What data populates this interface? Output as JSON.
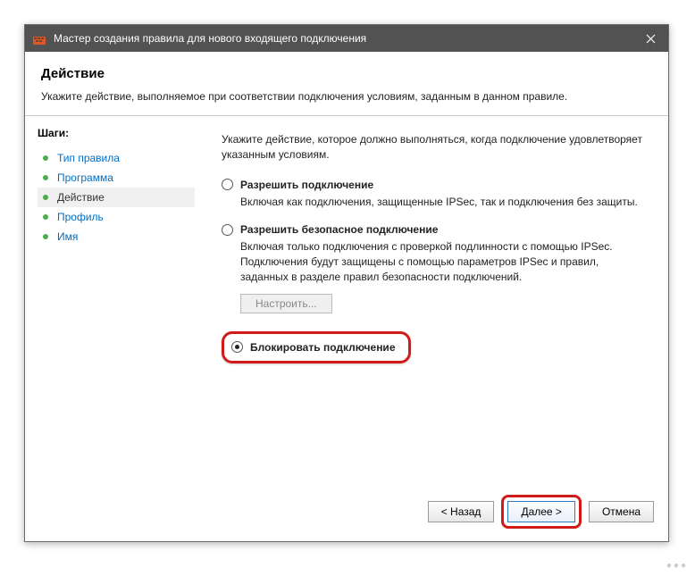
{
  "window": {
    "title": "Мастер создания правила для нового входящего подключения"
  },
  "header": {
    "title": "Действие",
    "subtitle": "Укажите действие, выполняемое при соответствии подключения условиям, заданным в данном правиле."
  },
  "sidebar": {
    "label": "Шаги:",
    "steps": [
      {
        "label": "Тип правила"
      },
      {
        "label": "Программа"
      },
      {
        "label": "Действие"
      },
      {
        "label": "Профиль"
      },
      {
        "label": "Имя"
      }
    ]
  },
  "content": {
    "intro": "Укажите действие, которое должно выполняться, когда подключение удовлетворяет указанным условиям.",
    "options": {
      "allow": {
        "label": "Разрешить подключение",
        "desc": "Включая как подключения, защищенные IPSec, так и подключения без защиты."
      },
      "allow_secure": {
        "label": "Разрешить безопасное подключение",
        "desc": "Включая только подключения с проверкой подлинности с помощью IPSec. Подключения будут защищены с помощью параметров IPSec и правил, заданных в разделе правил безопасности подключений.",
        "configure": "Настроить..."
      },
      "block": {
        "label": "Блокировать подключение"
      }
    }
  },
  "footer": {
    "back": "< Назад",
    "next": "Далее >",
    "cancel": "Отмена"
  }
}
